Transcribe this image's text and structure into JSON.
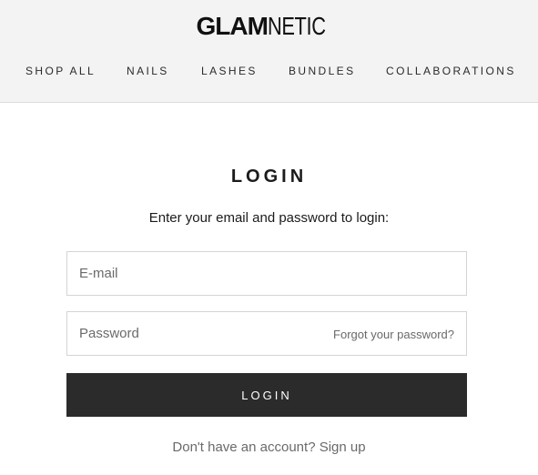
{
  "header": {
    "logo_bold": "GLAM",
    "logo_light": "NETIC",
    "nav": [
      "SHOP ALL",
      "NAILS",
      "LASHES",
      "BUNDLES",
      "COLLABORATIONS"
    ]
  },
  "login": {
    "title": "LOGIN",
    "subtitle": "Enter your email and password to login:",
    "email_placeholder": "E-mail",
    "password_placeholder": "Password",
    "forgot_label": "Forgot your password?",
    "submit_label": "LOGIN",
    "no_account_text": "Don't have an account?",
    "signup_label": "Sign up"
  }
}
